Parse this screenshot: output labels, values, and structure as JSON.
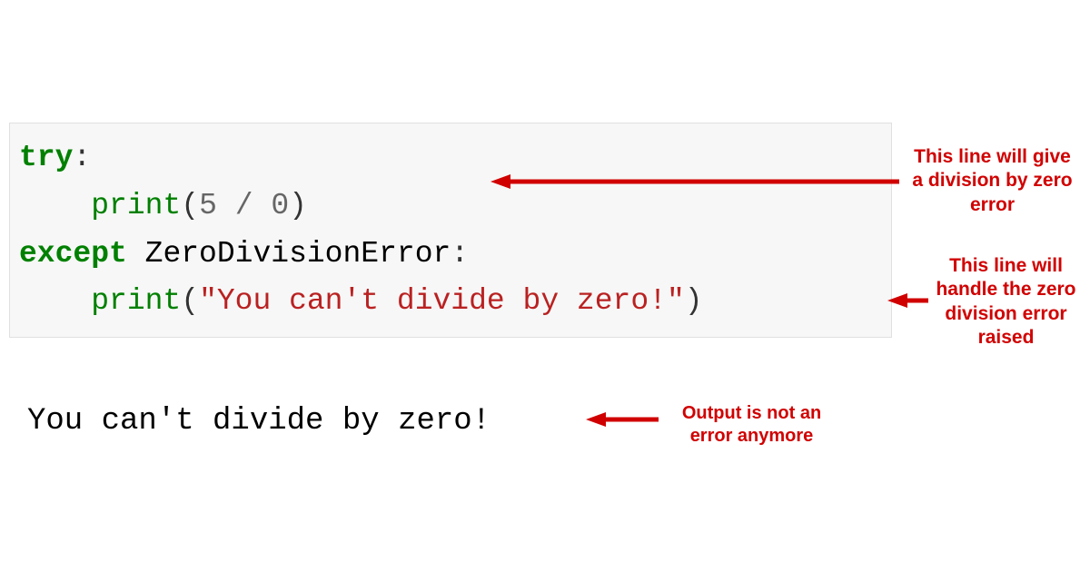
{
  "code": {
    "line1": {
      "try": "try",
      "colon": ":"
    },
    "line2": {
      "indent": "    ",
      "print": "print",
      "open": "(",
      "num1": "5",
      "space1": " ",
      "op": "/",
      "space2": " ",
      "num2": "0",
      "close": ")"
    },
    "line3": {
      "except": "except",
      "space": " ",
      "cls": "ZeroDivisionError",
      "colon": ":"
    },
    "line4": {
      "indent": "    ",
      "print": "print",
      "open": "(",
      "str": "\"You can't divide by zero!\"",
      "close": ")"
    }
  },
  "output": "You can't divide by zero!",
  "annotations": {
    "a1": "This line will give a division by zero error",
    "a2": "This line will handle the zero division error raised",
    "a3": "Output is not an error anymore"
  }
}
